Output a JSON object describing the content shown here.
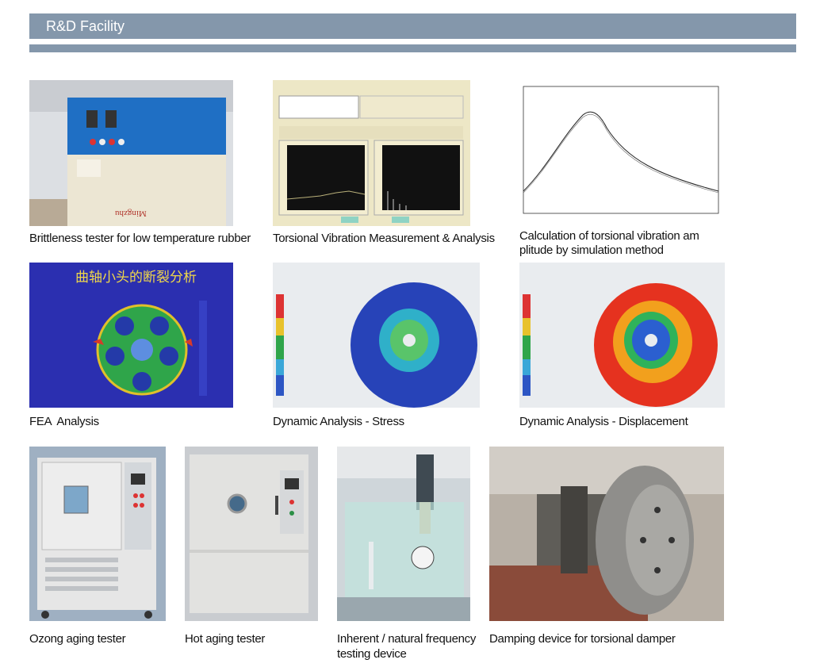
{
  "header": {
    "title": "R&D Facility"
  },
  "tiles": {
    "tester_brittleness": {
      "caption": "Brittleness tester for low temperature rubber",
      "brand": "Mingzhu"
    },
    "tv_measurement": {
      "caption": "Torsional Vibration Measurement & Analysis"
    },
    "tv_simulation": {
      "caption_line1": "Calculation of torsional vibration am",
      "caption_line2": "plitude by simulation method"
    },
    "fea": {
      "caption": "FEA  Analysis",
      "banner": "曲轴小头的断裂分析"
    },
    "dyn_stress": {
      "caption": "Dynamic Analysis - Stress"
    },
    "dyn_disp": {
      "caption": "Dynamic Analysis - Displacement"
    },
    "ozone": {
      "caption": "Ozong aging tester"
    },
    "hot_aging": {
      "caption": "Hot aging tester"
    },
    "frequency": {
      "caption_line1": "Inherent / natural frequency",
      "caption_line2": "testing device"
    },
    "damping": {
      "caption": "Damping device for torsional damper"
    }
  },
  "colors": {
    "header": "#8497ab",
    "machine_blue": "#1f6fc4",
    "fea_background": "#2b2fb0"
  }
}
